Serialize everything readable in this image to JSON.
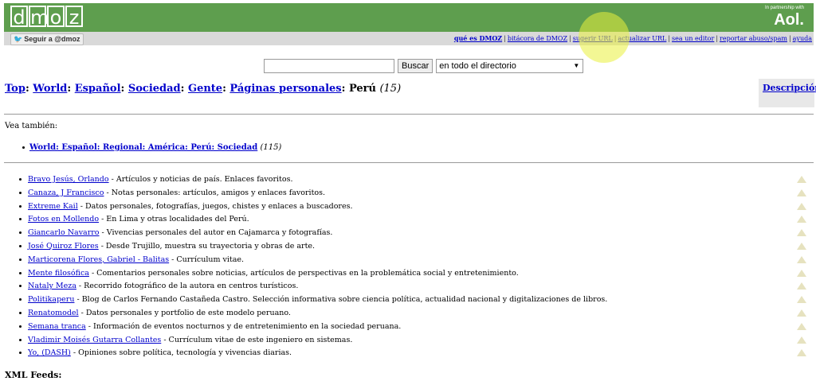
{
  "header": {
    "logo_letters": [
      "d",
      "m",
      "o",
      "z"
    ],
    "partner_small": "In partnership with",
    "partner_name": "Aol."
  },
  "subbar": {
    "follow": "Seguir a @dmoz",
    "nav": [
      "qué es DMOZ",
      "bitácora de DMOZ",
      "sugerir URL",
      "actualizar URL",
      "sea un editor",
      "reportar abuso/spam",
      "ayuda"
    ]
  },
  "search": {
    "query": "",
    "button": "Buscar",
    "scope": "en todo el directorio"
  },
  "breadcrumb": {
    "items": [
      "Top",
      "World",
      "Español",
      "Sociedad",
      "Gente",
      "Páginas personales"
    ],
    "current": "Perú",
    "count": "(15)"
  },
  "description_link": "Descripción",
  "see_also": {
    "label": "Vea también:",
    "link": "World: Español: Regional: América: Perú: Sociedad",
    "count": "(115)"
  },
  "sites": [
    {
      "title": "Bravo Jesús, Orlando",
      "desc": " - Artículos y noticias de país. Enlaces favoritos."
    },
    {
      "title": "Canaza, J Francisco",
      "desc": " - Notas personales: artículos, amigos y enlaces favoritos."
    },
    {
      "title": "Extreme Kail",
      "desc": " - Datos personales, fotografías, juegos, chistes y enlaces a buscadores."
    },
    {
      "title": "Fotos en Mollendo",
      "desc": " - En Lima y otras localidades del Perú."
    },
    {
      "title": "Giancarlo Navarro",
      "desc": " - Vivencias personales del autor en Cajamarca y fotografías."
    },
    {
      "title": "José Quiroz Flores",
      "desc": " - Desde Trujillo, muestra su trayectoria y obras de arte."
    },
    {
      "title": "Marticorena Flores, Gabriel - Balitas",
      "desc": " - Currículum vitae."
    },
    {
      "title": "Mente filosófica",
      "desc": " - Comentarios personales sobre noticias, artículos de perspectivas en la problemática social y entretenimiento."
    },
    {
      "title": "Nataly Meza",
      "desc": " - Recorrido fotográfico de la autora en centros turísticos."
    },
    {
      "title": "Politikaperu",
      "desc": " - Blog de Carlos Fernando Castañeda Castro. Selección informativa sobre ciencia política, actualidad nacional y digitalizaciones de libros."
    },
    {
      "title": "Renatomodel",
      "desc": " - Datos personales y portfolio de este modelo peruano."
    },
    {
      "title": "Semana tranca",
      "desc": " - Información de eventos nocturnos y de entretenimiento en la sociedad peruana."
    },
    {
      "title": "Vladimir Moisés Gutarra Collantes",
      "desc": " - Currículum vitae de este ingeniero en sistemas."
    },
    {
      "title": "Yo, (DASH)",
      "desc": " - Opiniones sobre política, tecnología y vivencias diarias."
    }
  ],
  "xml_feeds": "XML Feeds:",
  "colors": {
    "header": "#5e9e4e",
    "link": "#0000cc",
    "highlight": "#eaf03c"
  }
}
